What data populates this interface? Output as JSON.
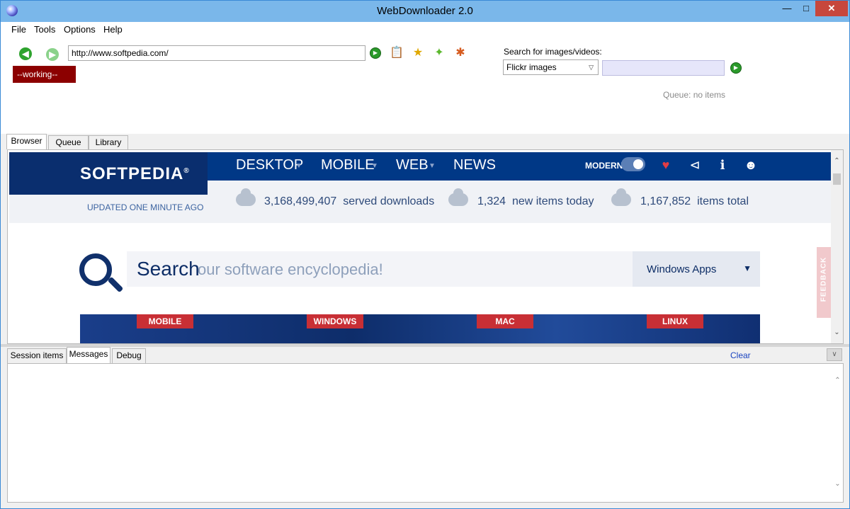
{
  "window": {
    "title": "WebDownloader 2.0",
    "minimize": "—",
    "maximize": "□",
    "close": "✕"
  },
  "menu": [
    "File",
    "Tools",
    "Options",
    "Help"
  ],
  "toolbar": {
    "back_icon": "arrow-left-icon",
    "forward_icon": "arrow-right-icon",
    "url_value": "http://www.softpedia.com/",
    "status": "--working--",
    "search_label": "Search for images/videos:",
    "search_source": "Flickr images",
    "search_value": "",
    "queue_status": "Queue: no items"
  },
  "tabs": [
    "Browser",
    "Queue",
    "Library"
  ],
  "site": {
    "logo": "SOFTPEDIA",
    "logo_mark": "®",
    "updated": "UPDATED ONE MINUTE AGO",
    "nav": [
      "DESKTOP",
      "MOBILE",
      "WEB",
      "NEWS"
    ],
    "modern": "MODERN",
    "stats": [
      {
        "value": "3,168,499,407",
        "label": "served downloads"
      },
      {
        "value": "1,324",
        "label": "new items today"
      },
      {
        "value": "1,167,852",
        "label": "items total"
      }
    ],
    "search_word": "Search",
    "search_placeholder": "our software encyclopedia!",
    "search_category": "Windows Apps",
    "categories": [
      "MOBILE",
      "WINDOWS",
      "MAC",
      "LINUX"
    ],
    "feedback": "FEEDBACK"
  },
  "lower_tabs": [
    "Session items",
    "Messages",
    "Debug"
  ],
  "clear_label": "Clear",
  "colors": {
    "status_bg": "#8c0000",
    "site_nav_bg": "#003886",
    "badge_red": "#c82f35",
    "search_field_bg": "#e6e6fa"
  }
}
